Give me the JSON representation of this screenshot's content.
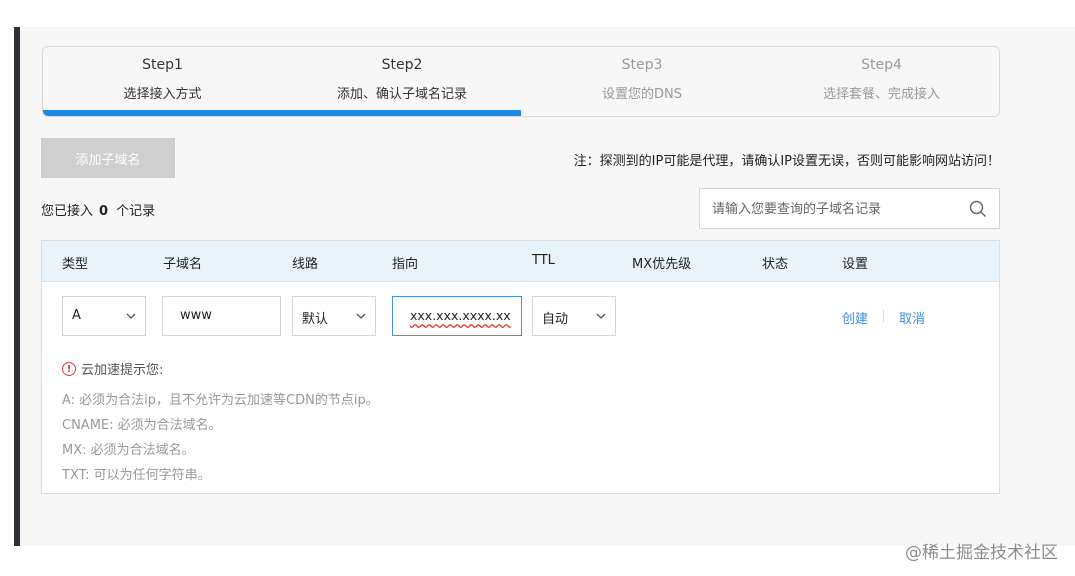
{
  "steps": [
    {
      "num": "Step1",
      "label": "选择接入方式",
      "state": "active"
    },
    {
      "num": "Step2",
      "label": "添加、确认子域名记录",
      "state": "active"
    },
    {
      "num": "Step3",
      "label": "设置您的DNS",
      "state": "inactive"
    },
    {
      "num": "Step4",
      "label": "选择套餐、完成接入",
      "state": "inactive"
    }
  ],
  "progress_fraction": 0.5,
  "toolbar": {
    "add_label": "添加子域名",
    "notice": "注：探测到的IP可能是代理，请确认IP设置无误，否则可能影响网站访问！"
  },
  "summary": {
    "prefix": "您已接入",
    "count": "0",
    "suffix": "个记录"
  },
  "search": {
    "placeholder": "请输入您要查询的子域名记录",
    "icon": "search-icon"
  },
  "table": {
    "headers": [
      "类型",
      "子域名",
      "线路",
      "指向",
      "TTL",
      "MX优先级",
      "状态",
      "设置"
    ],
    "row": {
      "type": "A",
      "subdomain": "www",
      "line": "默认",
      "target": "xxx.xxx.xxxx.xx",
      "ttl": "自动",
      "create_label": "创建",
      "cancel_label": "取消"
    }
  },
  "tips": {
    "title": "云加速提示您:",
    "items": [
      "A:  必须为合法ip，且不允许为云加速等CDN的节点ip。",
      "CNAME:  必须为合法域名。",
      "MX:  必须为合法域名。",
      "TXT:  可以为任何字符串。"
    ]
  },
  "watermark": "@稀土掘金技术社区",
  "colors": {
    "accent": "#1e88e5",
    "link": "#3a8ee6",
    "header_bg": "#e8f3fc",
    "warn": "#e23b3b"
  }
}
